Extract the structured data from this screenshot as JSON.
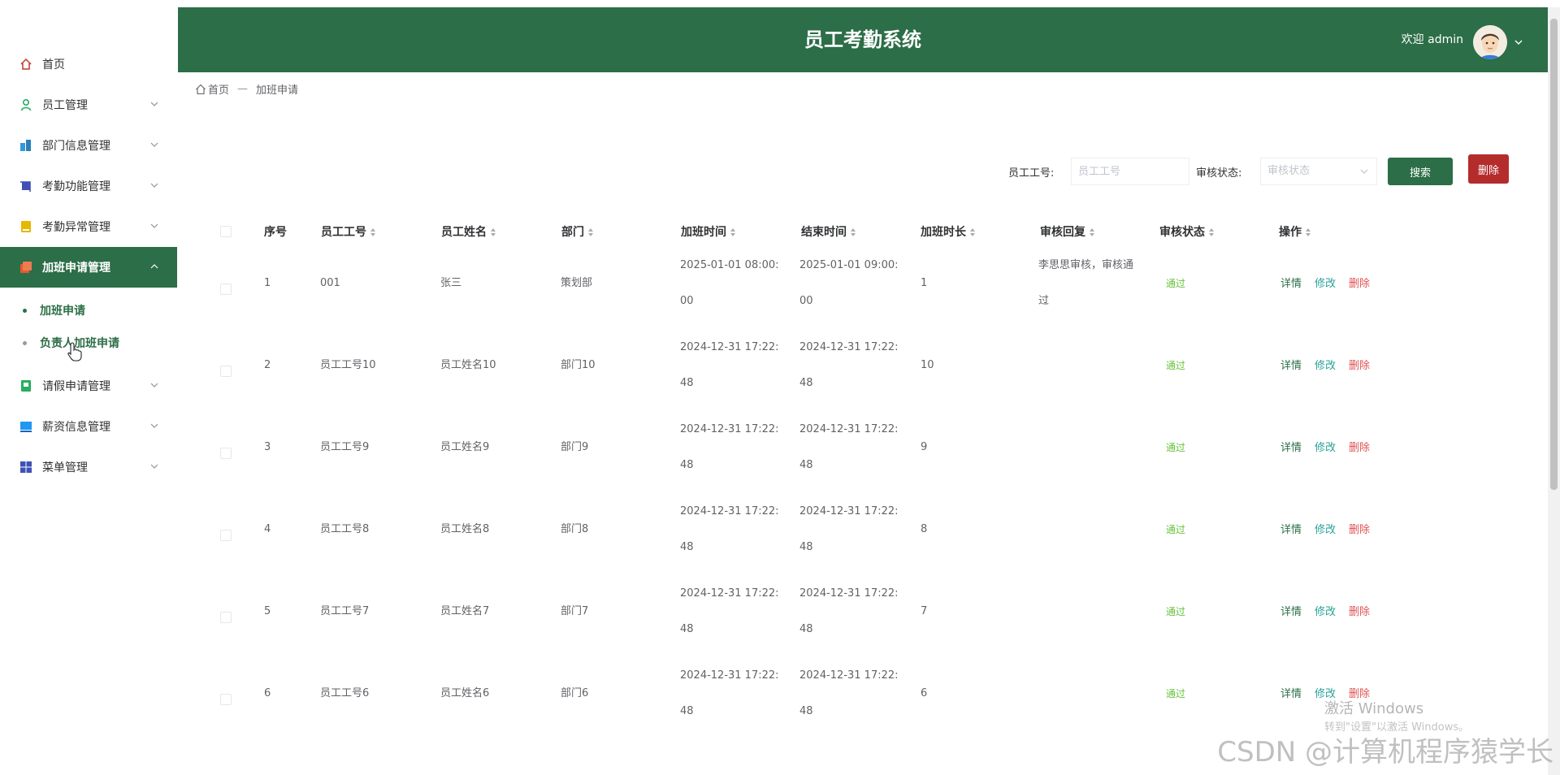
{
  "sidebar": {
    "items": [
      {
        "label": "首页",
        "icon": "home-icon",
        "color": "#c0392b"
      },
      {
        "label": "员工管理",
        "icon": "user-icon",
        "color": "#27ae60"
      },
      {
        "label": "部门信息管理",
        "icon": "building-icon",
        "color": "#3498db"
      },
      {
        "label": "考勤功能管理",
        "icon": "crop-icon",
        "color": "#3f51b5"
      },
      {
        "label": "考勤异常管理",
        "icon": "note-icon",
        "color": "#e6b800"
      },
      {
        "label": "加班申请管理",
        "icon": "overtime-icon",
        "color": "#e65a2c"
      },
      {
        "label": "请假申请管理",
        "icon": "book-icon",
        "color": "#27ae60"
      },
      {
        "label": "薪资信息管理",
        "icon": "monitor-icon",
        "color": "#2196f3"
      },
      {
        "label": "菜单管理",
        "icon": "grid-icon",
        "color": "#3f51b5"
      }
    ],
    "sub_items": [
      "加班申请",
      "负责人加班申请"
    ]
  },
  "header": {
    "title": "员工考勤系统",
    "welcome": "欢迎 admin"
  },
  "breadcrumb": {
    "home": "首页",
    "separator": "—",
    "current": "加班申请"
  },
  "search": {
    "employee_no_label": "员工工号:",
    "employee_no_placeholder": "员工工号",
    "status_label": "审核状态:",
    "status_placeholder": "审核状态",
    "search_button": "搜索",
    "delete_button": "删除"
  },
  "table": {
    "columns": [
      "序号",
      "员工工号",
      "员工姓名",
      "部门",
      "加班时间",
      "结束时间",
      "加班时长",
      "审核回复",
      "审核状态",
      "操作"
    ],
    "actions": {
      "detail": "详情",
      "edit": "修改",
      "remove": "删除"
    },
    "rows": [
      {
        "index": "1",
        "emp_no": "001",
        "name": "张三",
        "dept": "策划部",
        "start": "2025-01-01 08:00:00",
        "end": "2025-01-01 09:00:00",
        "hours": "1",
        "reply": "李思思审核，审核通过",
        "status": "通过"
      },
      {
        "index": "2",
        "emp_no": "员工工号10",
        "name": "员工姓名10",
        "dept": "部门10",
        "start": "2024-12-31 17:22:48",
        "end": "2024-12-31 17:22:48",
        "hours": "10",
        "reply": "",
        "status": "通过"
      },
      {
        "index": "3",
        "emp_no": "员工工号9",
        "name": "员工姓名9",
        "dept": "部门9",
        "start": "2024-12-31 17:22:48",
        "end": "2024-12-31 17:22:48",
        "hours": "9",
        "reply": "",
        "status": "通过"
      },
      {
        "index": "4",
        "emp_no": "员工工号8",
        "name": "员工姓名8",
        "dept": "部门8",
        "start": "2024-12-31 17:22:48",
        "end": "2024-12-31 17:22:48",
        "hours": "8",
        "reply": "",
        "status": "通过"
      },
      {
        "index": "5",
        "emp_no": "员工工号7",
        "name": "员工姓名7",
        "dept": "部门7",
        "start": "2024-12-31 17:22:48",
        "end": "2024-12-31 17:22:48",
        "hours": "7",
        "reply": "",
        "status": "通过"
      },
      {
        "index": "6",
        "emp_no": "员工工号6",
        "name": "员工姓名6",
        "dept": "部门6",
        "start": "2024-12-31 17:22:48",
        "end": "2024-12-31 17:22:48",
        "hours": "6",
        "reply": "",
        "status": "通过"
      }
    ]
  },
  "watermark": {
    "line1": "激活 Windows",
    "line2": "转到\"设置\"以激活 Windows。",
    "csdn": "CSDN @计算机程序猿学长"
  },
  "colors": {
    "primary": "#2c6e47",
    "danger": "#b52c2c",
    "pass": "#67c23a"
  }
}
